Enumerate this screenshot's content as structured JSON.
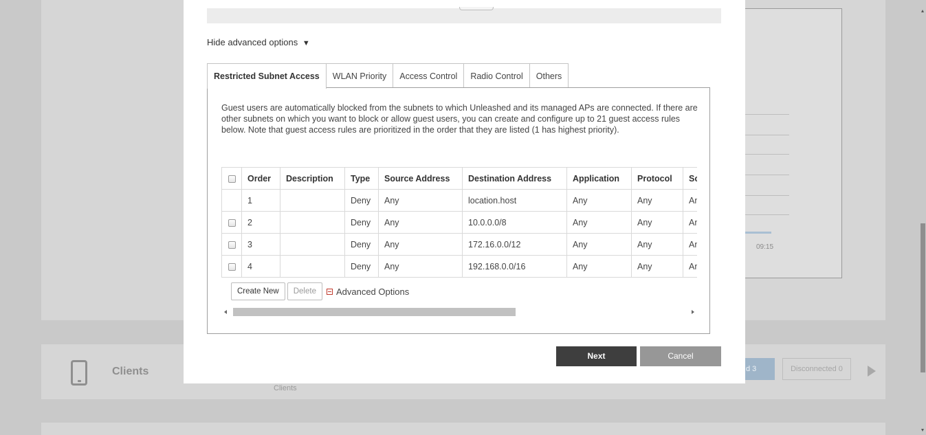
{
  "background": {
    "chart_tick": "09:15",
    "clients_title": "Clients",
    "clients_subtitle": "Clients",
    "connected_badge": "d 3",
    "disconnected_badge": "Disconnected 0"
  },
  "modal": {
    "advanced_toggle": "Hide advanced options",
    "advanced_toggle_icon": "▼",
    "tabs": [
      {
        "label": "Restricted Subnet Access",
        "active": true
      },
      {
        "label": "WLAN Priority",
        "active": false
      },
      {
        "label": "Access Control",
        "active": false
      },
      {
        "label": "Radio Control",
        "active": false
      },
      {
        "label": "Others",
        "active": false
      }
    ],
    "description": "Guest users are automatically blocked from the subnets to which Unleashed and its managed APs are connected. If there are other subnets on which you want to block or allow guest users, you can create and configure up to 21 guest access rules below. Note that guest access rules are prioritized in the order that they are listed (1 has highest priority).",
    "table": {
      "headers": [
        "Order",
        "Description",
        "Type",
        "Source Address",
        "Destination Address",
        "Application",
        "Protocol",
        "So"
      ],
      "rows": [
        {
          "checkbox": false,
          "cells": [
            "1",
            "",
            "Deny",
            "Any",
            "location.host",
            "Any",
            "Any",
            "An"
          ]
        },
        {
          "checkbox": true,
          "cells": [
            "2",
            "",
            "Deny",
            "Any",
            "10.0.0.0/8",
            "Any",
            "Any",
            "An"
          ]
        },
        {
          "checkbox": true,
          "cells": [
            "3",
            "",
            "Deny",
            "Any",
            "172.16.0.0/12",
            "Any",
            "Any",
            "An"
          ]
        },
        {
          "checkbox": true,
          "cells": [
            "4",
            "",
            "Deny",
            "Any",
            "192.168.0.0/16",
            "Any",
            "Any",
            "An"
          ]
        }
      ]
    },
    "create_new_label": "Create New",
    "delete_label": "Delete",
    "advanced_options_label": "Advanced Options",
    "next_label": "Next",
    "cancel_label": "Cancel"
  },
  "colors": {
    "next_button": "#3e3e3e",
    "cancel_button": "#979797",
    "advanced_icon": "#c0392b"
  }
}
